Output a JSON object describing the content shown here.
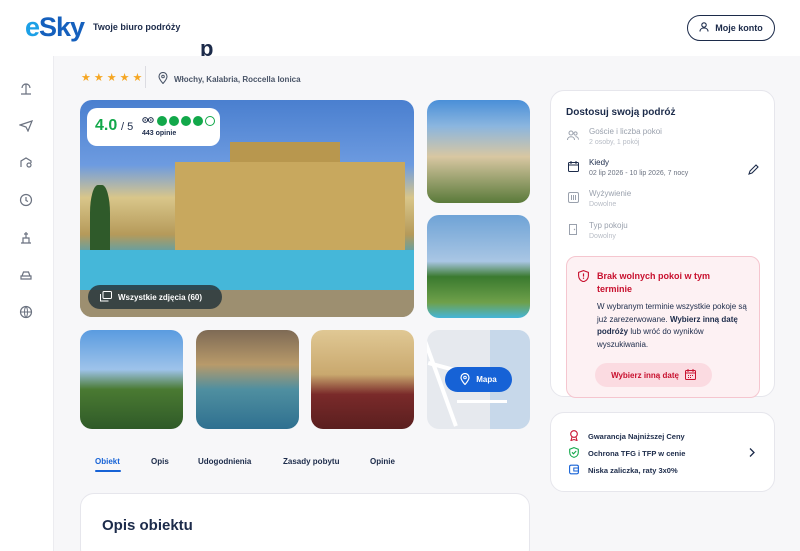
{
  "header": {
    "logo": "eSky",
    "tagline": "Twoje biuro podróży",
    "account_label": "Moje konto"
  },
  "sidebar": {
    "items": [
      {
        "icon": "beach-umbrella-icon"
      },
      {
        "icon": "plane-icon"
      },
      {
        "icon": "hotel-search-icon"
      },
      {
        "icon": "clock-icon"
      },
      {
        "icon": "attraction-icon"
      },
      {
        "icon": "car-icon"
      },
      {
        "icon": "globe-icon"
      }
    ]
  },
  "hotel": {
    "title_partial": "p",
    "stars": 5,
    "location": "Włochy, Kalabria, Roccella Ionica"
  },
  "rating": {
    "score": "4.0",
    "max": "/ 5",
    "dots_filled": 4,
    "dots_total": 5,
    "reviews": "443 opinie"
  },
  "gallery": {
    "all_photos_label": "Wszystkie zdjęcia (60)",
    "map_label": "Mapa"
  },
  "tabs": [
    {
      "label": "Obiekt",
      "active": true
    },
    {
      "label": "Opis",
      "active": false
    },
    {
      "label": "Udogodnienia",
      "active": false
    },
    {
      "label": "Zasady pobytu",
      "active": false
    },
    {
      "label": "Opinie",
      "active": false
    }
  ],
  "description": {
    "title": "Opis obiektu"
  },
  "trip": {
    "title": "Dostosuj swoją podróż",
    "rows": [
      {
        "label": "Goście i liczba pokoi",
        "value": "2 osoby, 1 pokój",
        "icon": "guests-icon",
        "active": false
      },
      {
        "label": "Kiedy",
        "value": "02 lip 2026 - 10 lip 2026, 7 nocy",
        "icon": "calendar-icon",
        "active": true
      },
      {
        "label": "Wyżywienie",
        "value": "Dowolne",
        "icon": "meal-icon",
        "active": false
      },
      {
        "label": "Typ pokoju",
        "value": "Dowolny",
        "icon": "door-icon",
        "active": false
      }
    ],
    "alert": {
      "title": "Brak wolnych pokoi w tym terminie",
      "text_1": "W wybranym terminie wszystkie pokoje są już zarezerwowane.",
      "text_bold": "Wybierz inną datę podróży",
      "text_2": "lub wróć do wyników wyszukiwania.",
      "button": "Wybierz inną datę"
    }
  },
  "benefits": [
    {
      "label": "Gwarancja Najniższej Ceny",
      "icon": "medal-icon"
    },
    {
      "label": "Ochrona TFG i TFP w cenie",
      "icon": "shield-check-icon"
    },
    {
      "label": "Niska zaliczka, raty 3x0%",
      "icon": "wallet-icon"
    }
  ],
  "colors": {
    "brand_blue": "#1662d6",
    "rating_green": "#12a84a",
    "alert_red": "#c8102e",
    "star_orange": "#f5a623"
  }
}
